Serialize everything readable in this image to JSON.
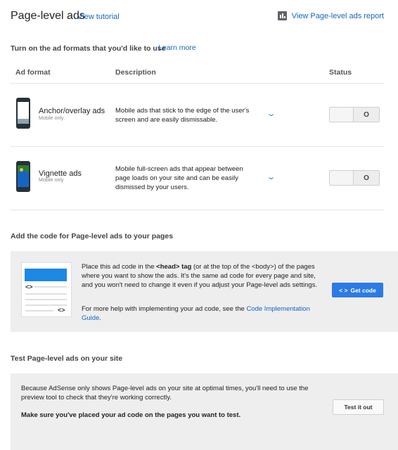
{
  "header": {
    "title": "Page-level ads",
    "tutorial_link": "View tutorial",
    "report_link": "View Page-level ads report",
    "report_icon": "bar-chart-icon"
  },
  "formats_section": {
    "heading": "Turn on the ad formats that you'd like to use",
    "learn_more": "Learn more",
    "columns": {
      "format": "Ad format",
      "description": "Description",
      "status": "Status"
    },
    "rows": [
      {
        "name": "Anchor/overlay ads",
        "sub": "Mobile only",
        "description": "Mobile ads that stick to the edge of the user's screen and are easily dismissable.",
        "toggle": "O",
        "icon": "phone-anchor-icon"
      },
      {
        "name": "Vignette ads",
        "sub": "Mobile only",
        "description": "Mobile full-screen ads that appear between page loads on your site and can be easily dismissed by your users.",
        "toggle": "O",
        "icon": "phone-vignette-icon"
      }
    ]
  },
  "code_section": {
    "heading": "Add the code for Page-level ads to your pages",
    "para1_pre": "Place this ad code in the ",
    "para1_bold": "<head> tag",
    "para1_post": " (or at the top of the <body>) of the pages where you want to show the ads. It's the same ad code for every page and site, and you won't need to change it even if you adjust your Page-level ads settings.",
    "para2_pre": "For more help with implementing your ad code, see the ",
    "para2_link": "Code Implementation Guide",
    "para2_post": ".",
    "button": "Get code",
    "button_icon_text": "< >",
    "illus_tag": "<>"
  },
  "test_section": {
    "heading": "Test Page-level ads on your site",
    "para1": "Because AdSense only shows Page-level ads on your site at optimal times, you'll need to use the preview tool to check that they're working correctly.",
    "para2": "Make sure you've placed your ad code on the pages you want to test.",
    "button": "Test it out"
  },
  "colors": {
    "link": "#1565c0",
    "primary_button": "#2c7be5",
    "panel": "#eeeeee"
  }
}
